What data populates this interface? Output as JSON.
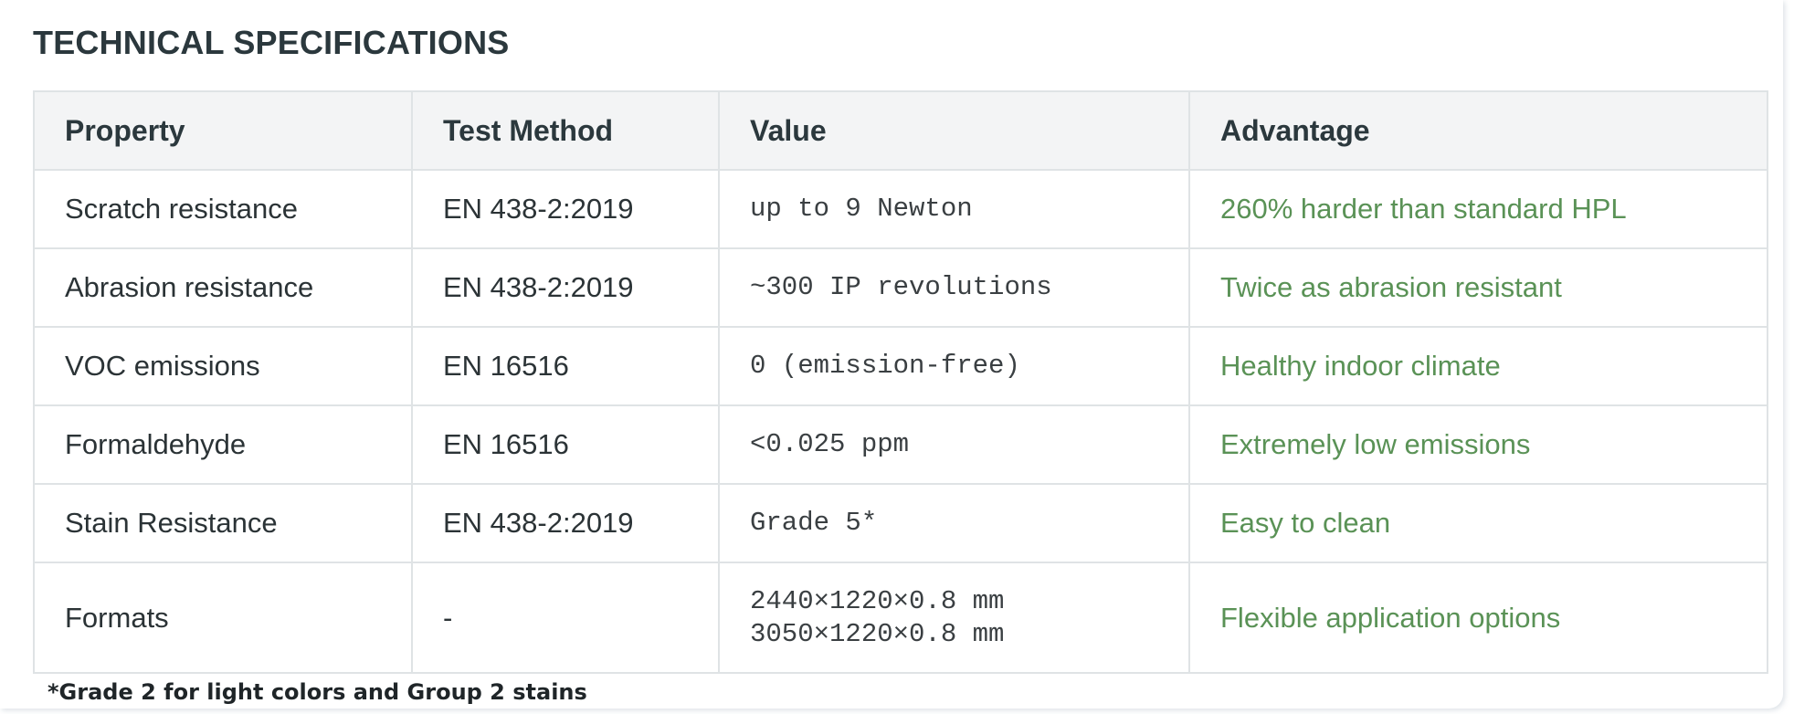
{
  "title": "TECHNICAL SPECIFICATIONS",
  "table": {
    "headers": {
      "property": "Property",
      "test_method": "Test Method",
      "value": "Value",
      "advantage": "Advantage"
    },
    "rows": [
      {
        "property": "Scratch resistance",
        "test_method": "EN 438-2:2019",
        "value": [
          "up to 9 Newton"
        ],
        "advantage": "260% harder than standard HPL"
      },
      {
        "property": "Abrasion resistance",
        "test_method": "EN 438-2:2019",
        "value": [
          "~300 IP revolutions"
        ],
        "advantage": "Twice as abrasion resistant"
      },
      {
        "property": "VOC emissions",
        "test_method": "EN 16516",
        "value": [
          "0 (emission-free)"
        ],
        "advantage": "Healthy indoor climate"
      },
      {
        "property": "Formaldehyde",
        "test_method": "EN 16516",
        "value": [
          "<0.025 ppm"
        ],
        "advantage": "Extremely low emissions"
      },
      {
        "property": "Stain Resistance",
        "test_method": "EN 438-2:2019",
        "value": [
          "Grade 5*"
        ],
        "advantage": "Easy to clean"
      },
      {
        "property": "Formats",
        "test_method": "-",
        "value": [
          "2440×1220×0.8 mm",
          "3050×1220×0.8 mm"
        ],
        "advantage": "Flexible application options"
      }
    ]
  },
  "footnote": "*Grade 2 for light colors and Group 2 stains",
  "colors": {
    "heading": "#2b383d",
    "advantage_text": "#5a9256",
    "header_background": "#f3f4f5",
    "border": "#dfe3e5"
  }
}
